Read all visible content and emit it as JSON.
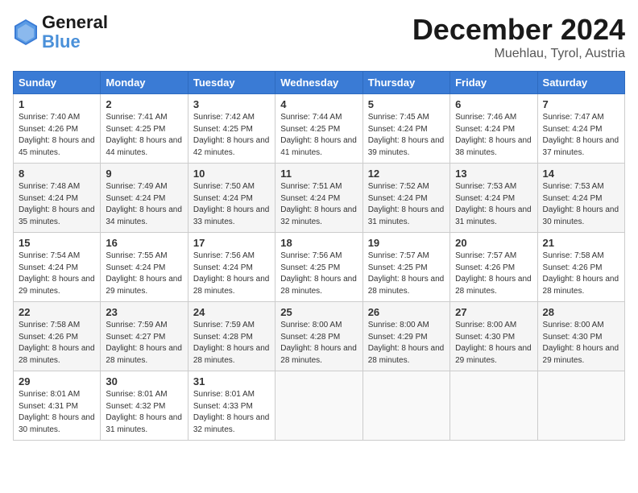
{
  "logo": {
    "general": "General",
    "blue": "Blue"
  },
  "header": {
    "month_year": "December 2024",
    "location": "Muehlau, Tyrol, Austria"
  },
  "days_of_week": [
    "Sunday",
    "Monday",
    "Tuesday",
    "Wednesday",
    "Thursday",
    "Friday",
    "Saturday"
  ],
  "weeks": [
    [
      {
        "day": "1",
        "sunrise": "Sunrise: 7:40 AM",
        "sunset": "Sunset: 4:26 PM",
        "daylight": "Daylight: 8 hours and 45 minutes."
      },
      {
        "day": "2",
        "sunrise": "Sunrise: 7:41 AM",
        "sunset": "Sunset: 4:25 PM",
        "daylight": "Daylight: 8 hours and 44 minutes."
      },
      {
        "day": "3",
        "sunrise": "Sunrise: 7:42 AM",
        "sunset": "Sunset: 4:25 PM",
        "daylight": "Daylight: 8 hours and 42 minutes."
      },
      {
        "day": "4",
        "sunrise": "Sunrise: 7:44 AM",
        "sunset": "Sunset: 4:25 PM",
        "daylight": "Daylight: 8 hours and 41 minutes."
      },
      {
        "day": "5",
        "sunrise": "Sunrise: 7:45 AM",
        "sunset": "Sunset: 4:24 PM",
        "daylight": "Daylight: 8 hours and 39 minutes."
      },
      {
        "day": "6",
        "sunrise": "Sunrise: 7:46 AM",
        "sunset": "Sunset: 4:24 PM",
        "daylight": "Daylight: 8 hours and 38 minutes."
      },
      {
        "day": "7",
        "sunrise": "Sunrise: 7:47 AM",
        "sunset": "Sunset: 4:24 PM",
        "daylight": "Daylight: 8 hours and 37 minutes."
      }
    ],
    [
      {
        "day": "8",
        "sunrise": "Sunrise: 7:48 AM",
        "sunset": "Sunset: 4:24 PM",
        "daylight": "Daylight: 8 hours and 35 minutes."
      },
      {
        "day": "9",
        "sunrise": "Sunrise: 7:49 AM",
        "sunset": "Sunset: 4:24 PM",
        "daylight": "Daylight: 8 hours and 34 minutes."
      },
      {
        "day": "10",
        "sunrise": "Sunrise: 7:50 AM",
        "sunset": "Sunset: 4:24 PM",
        "daylight": "Daylight: 8 hours and 33 minutes."
      },
      {
        "day": "11",
        "sunrise": "Sunrise: 7:51 AM",
        "sunset": "Sunset: 4:24 PM",
        "daylight": "Daylight: 8 hours and 32 minutes."
      },
      {
        "day": "12",
        "sunrise": "Sunrise: 7:52 AM",
        "sunset": "Sunset: 4:24 PM",
        "daylight": "Daylight: 8 hours and 31 minutes."
      },
      {
        "day": "13",
        "sunrise": "Sunrise: 7:53 AM",
        "sunset": "Sunset: 4:24 PM",
        "daylight": "Daylight: 8 hours and 31 minutes."
      },
      {
        "day": "14",
        "sunrise": "Sunrise: 7:53 AM",
        "sunset": "Sunset: 4:24 PM",
        "daylight": "Daylight: 8 hours and 30 minutes."
      }
    ],
    [
      {
        "day": "15",
        "sunrise": "Sunrise: 7:54 AM",
        "sunset": "Sunset: 4:24 PM",
        "daylight": "Daylight: 8 hours and 29 minutes."
      },
      {
        "day": "16",
        "sunrise": "Sunrise: 7:55 AM",
        "sunset": "Sunset: 4:24 PM",
        "daylight": "Daylight: 8 hours and 29 minutes."
      },
      {
        "day": "17",
        "sunrise": "Sunrise: 7:56 AM",
        "sunset": "Sunset: 4:24 PM",
        "daylight": "Daylight: 8 hours and 28 minutes."
      },
      {
        "day": "18",
        "sunrise": "Sunrise: 7:56 AM",
        "sunset": "Sunset: 4:25 PM",
        "daylight": "Daylight: 8 hours and 28 minutes."
      },
      {
        "day": "19",
        "sunrise": "Sunrise: 7:57 AM",
        "sunset": "Sunset: 4:25 PM",
        "daylight": "Daylight: 8 hours and 28 minutes."
      },
      {
        "day": "20",
        "sunrise": "Sunrise: 7:57 AM",
        "sunset": "Sunset: 4:26 PM",
        "daylight": "Daylight: 8 hours and 28 minutes."
      },
      {
        "day": "21",
        "sunrise": "Sunrise: 7:58 AM",
        "sunset": "Sunset: 4:26 PM",
        "daylight": "Daylight: 8 hours and 28 minutes."
      }
    ],
    [
      {
        "day": "22",
        "sunrise": "Sunrise: 7:58 AM",
        "sunset": "Sunset: 4:26 PM",
        "daylight": "Daylight: 8 hours and 28 minutes."
      },
      {
        "day": "23",
        "sunrise": "Sunrise: 7:59 AM",
        "sunset": "Sunset: 4:27 PM",
        "daylight": "Daylight: 8 hours and 28 minutes."
      },
      {
        "day": "24",
        "sunrise": "Sunrise: 7:59 AM",
        "sunset": "Sunset: 4:28 PM",
        "daylight": "Daylight: 8 hours and 28 minutes."
      },
      {
        "day": "25",
        "sunrise": "Sunrise: 8:00 AM",
        "sunset": "Sunset: 4:28 PM",
        "daylight": "Daylight: 8 hours and 28 minutes."
      },
      {
        "day": "26",
        "sunrise": "Sunrise: 8:00 AM",
        "sunset": "Sunset: 4:29 PM",
        "daylight": "Daylight: 8 hours and 28 minutes."
      },
      {
        "day": "27",
        "sunrise": "Sunrise: 8:00 AM",
        "sunset": "Sunset: 4:30 PM",
        "daylight": "Daylight: 8 hours and 29 minutes."
      },
      {
        "day": "28",
        "sunrise": "Sunrise: 8:00 AM",
        "sunset": "Sunset: 4:30 PM",
        "daylight": "Daylight: 8 hours and 29 minutes."
      }
    ],
    [
      {
        "day": "29",
        "sunrise": "Sunrise: 8:01 AM",
        "sunset": "Sunset: 4:31 PM",
        "daylight": "Daylight: 8 hours and 30 minutes."
      },
      {
        "day": "30",
        "sunrise": "Sunrise: 8:01 AM",
        "sunset": "Sunset: 4:32 PM",
        "daylight": "Daylight: 8 hours and 31 minutes."
      },
      {
        "day": "31",
        "sunrise": "Sunrise: 8:01 AM",
        "sunset": "Sunset: 4:33 PM",
        "daylight": "Daylight: 8 hours and 32 minutes."
      },
      null,
      null,
      null,
      null
    ]
  ]
}
